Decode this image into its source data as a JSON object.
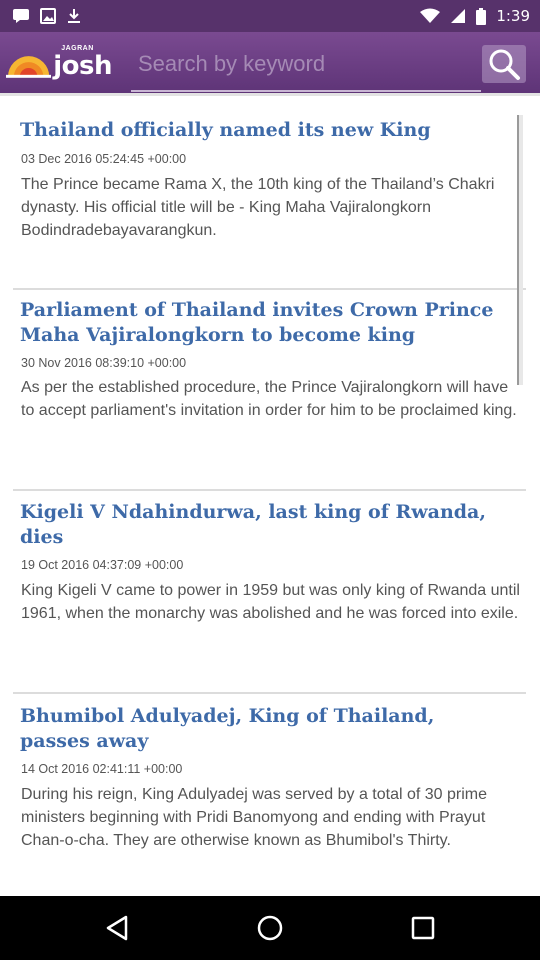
{
  "status_bar": {
    "time": "1:39",
    "icons": [
      "message-icon",
      "photo-icon",
      "download-icon",
      "wifi-icon",
      "signal-icon",
      "battery-icon"
    ]
  },
  "header": {
    "logo_sub": "JAGRAN",
    "logo_text": "josh",
    "search_placeholder": "Search by keyword",
    "accent_color": "#6a3d82"
  },
  "articles": [
    {
      "title": "Thailand officially named its new King",
      "date": "03 Dec 2016 05:24:45 +00:00",
      "summary": "The Prince became Rama X, the 10th king of the Thailand’s Chakri dynasty. His official title will be - King Maha Vajiralongkorn Bodindradebayavarangkun."
    },
    {
      "title": "Parliament of Thailand invites Crown Prince Maha Vajiralongkorn to become king",
      "date": "30 Nov 2016 08:39:10 +00:00",
      "summary": "As per the established procedure, the Prince Vajiralongkorn will have to accept parliament's invitation in order for him to be proclaimed king."
    },
    {
      "title": "Kigeli V Ndahindurwa, last king of Rwanda, dies",
      "date": "19 Oct 2016 04:37:09 +00:00",
      "summary": "King Kigeli V came to power in 1959 but was only king of Rwanda until 1961, when the monarchy was abolished and he was forced into exile."
    },
    {
      "title": "Bhumibol Adulyadej, King of Thailand, passes away",
      "date": "14 Oct 2016 02:41:11 +00:00",
      "summary": "During his reign, King Adulyadej was served by a total of 30 prime ministers beginning with Pridi Banomyong and ending with Prayut Chan-o-cha. They are otherwise known as Bhumibol's Thirty."
    }
  ],
  "nav": {
    "icons": [
      "back-icon",
      "home-icon",
      "recents-icon"
    ]
  }
}
